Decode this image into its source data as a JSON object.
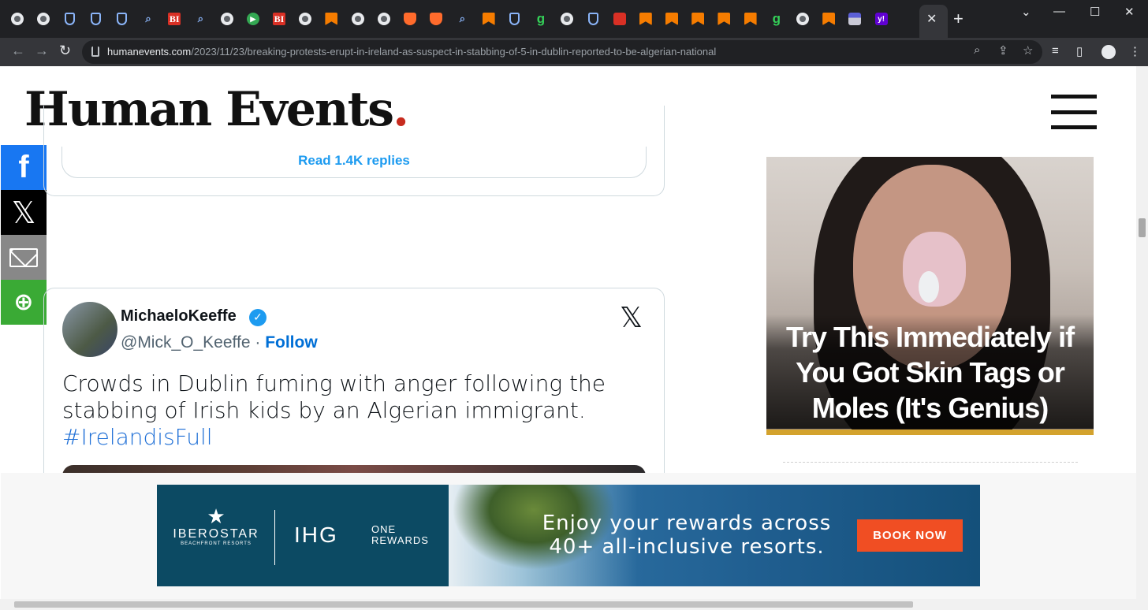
{
  "browser": {
    "tabs": [
      {
        "icon": "globe-icon"
      },
      {
        "icon": "globe-icon"
      },
      {
        "icon": "shield-icon"
      },
      {
        "icon": "shield-icon"
      },
      {
        "icon": "shield-icon"
      },
      {
        "icon": "search-icon"
      },
      {
        "icon": "business-insider-icon",
        "text": "BI"
      },
      {
        "icon": "search-icon"
      },
      {
        "icon": "globe-icon"
      },
      {
        "icon": "play-icon"
      },
      {
        "icon": "business-insider-icon",
        "text": "BI"
      },
      {
        "icon": "globe-icon"
      },
      {
        "icon": "bookmark-icon"
      },
      {
        "icon": "globe-icon"
      },
      {
        "icon": "globe-icon"
      },
      {
        "icon": "brave-icon"
      },
      {
        "icon": "brave-icon"
      },
      {
        "icon": "search-icon"
      },
      {
        "icon": "bookmark-icon"
      },
      {
        "icon": "shield-icon"
      },
      {
        "icon": "g-icon",
        "text": "g"
      },
      {
        "icon": "globe-icon"
      },
      {
        "icon": "shield-icon"
      },
      {
        "icon": "red-app-icon"
      },
      {
        "icon": "bookmark-icon"
      },
      {
        "icon": "bookmark-icon"
      },
      {
        "icon": "bookmark-icon"
      },
      {
        "icon": "bookmark-icon"
      },
      {
        "icon": "bookmark-icon"
      },
      {
        "icon": "g-icon",
        "text": "g"
      },
      {
        "icon": "globe-icon"
      },
      {
        "icon": "bookmark-icon"
      },
      {
        "icon": "flag-icon"
      },
      {
        "icon": "yahoo-icon",
        "text": "y!"
      }
    ],
    "close_tab": "✕",
    "new_tab": "+",
    "window_controls": {
      "dropdown": "⌄",
      "minimize": "—",
      "maximize": "☐",
      "close": "✕"
    },
    "url_host": "humanevents.com",
    "url_path": "/2023/11/23/breaking-protests-erupt-in-ireland-as-suspect-in-stabbing-of-5-in-dublin-reported-to-be-algerian-national"
  },
  "site": {
    "logo": "Human Events",
    "logo_dot": "."
  },
  "share": {
    "facebook": "f",
    "x": "𝕏",
    "more": "⊕"
  },
  "tweet1": {
    "replies_label": "Read 1.4K replies"
  },
  "tweet2": {
    "name": "MichaeloKeeffe",
    "handle": "@Mick_O_Keeffe",
    "separator": " · ",
    "follow": "Follow",
    "x_logo": "𝕏",
    "text": "Crowds in Dublin fuming with anger following the stabbing of Irish kids by an Algerian immigrant.",
    "hashtag": "#IrelandisFull"
  },
  "ad_right": {
    "title": "Try This Immediately if You Got Skin Tags or Moles (It's Genius)"
  },
  "banner": {
    "brand": "IBEROSTAR",
    "brand_sub": "BEACHFRONT RESORTS",
    "ihg": "IHG",
    "ihg_sub1": "ONE",
    "ihg_sub2": "REWARDS",
    "headline1": "Enjoy your rewards across",
    "headline2": "40+ all-inclusive resorts.",
    "cta": "BOOK NOW"
  },
  "colors": {
    "chrome_bg": "#202124",
    "logo_dot": "#c72b1e",
    "link_blue": "#006fd6",
    "facebook": "#1877f2",
    "email": "#888888",
    "share_more": "#3aaa35",
    "ad_accent": "#d3a22d",
    "cta_orange": "#f04e23"
  }
}
